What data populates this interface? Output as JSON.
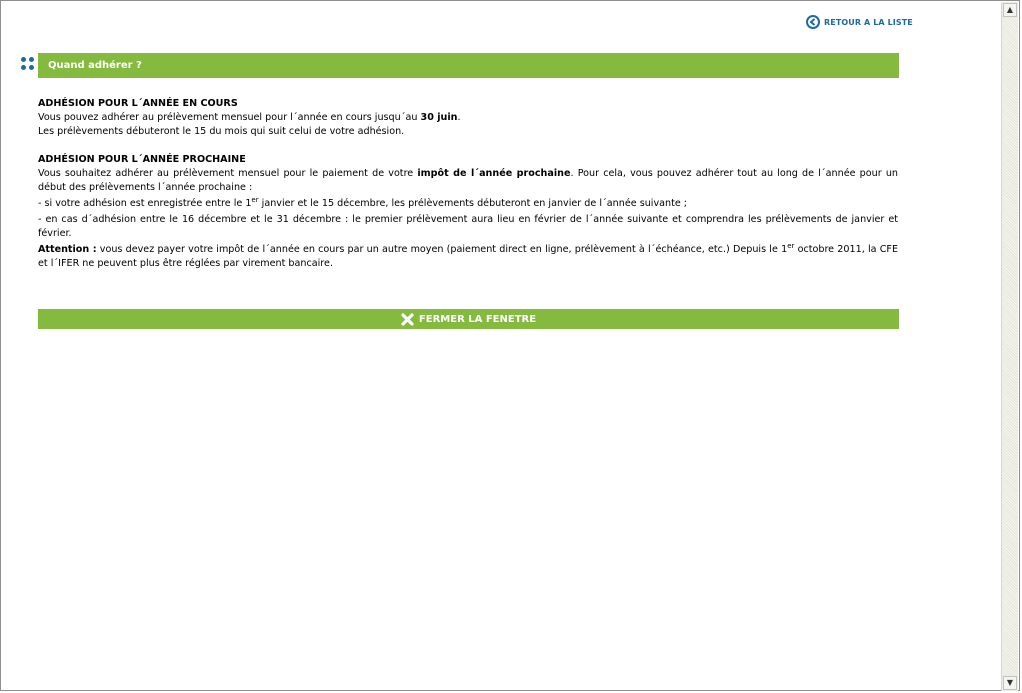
{
  "header": {
    "back_link_label": "RETOUR A LA LISTE"
  },
  "section": {
    "title": "Quand adhérer ?"
  },
  "current_year": {
    "heading": "ADHÉSION POUR L´ANNÉE EN COURS",
    "line1_prefix": "Vous pouvez adhérer au prélèvement mensuel pour l´année en cours jusqu´au ",
    "line1_bold": "30 juin",
    "line1_suffix": ".",
    "line2": "Les prélèvements débuteront le 15 du mois qui suit celui de votre adhésion."
  },
  "next_year": {
    "heading": "ADHÉSION POUR L´ANNÉE PROCHAINE",
    "intro_prefix": "Vous souhaitez adhérer au prélèvement mensuel pour le paiement de votre ",
    "intro_bold": "impôt de l´année prochaine",
    "intro_suffix": ". Pour cela, vous pouvez adhérer tout au long de l´année pour un début des prélèvements l´année prochaine :",
    "bullet1_prefix": "- si votre adhésion est enregistrée entre le 1",
    "bullet1_sup": "er",
    "bullet1_suffix": " janvier et le 15 décembre, les prélèvements débuteront en janvier de l´année suivante ;",
    "bullet2": "- en cas d´adhésion entre le 16 décembre et le 31 décembre :  le premier prélèvement aura lieu en février de l´année suivante et comprendra les prélèvements de janvier et février.",
    "attention_bold": "Attention :",
    "attention_text1": " vous devez payer votre impôt de l´année en cours par un autre moyen (paiement direct en ligne, prélèvement à l´échéance, etc.) Depuis le 1",
    "attention_sup": "er",
    "attention_text2": " octobre 2011, la CFE et l´IFER ne peuvent plus être réglées par virement bancaire."
  },
  "footer": {
    "close_label": "FERMER LA FENETRE"
  },
  "colors": {
    "green": "#84bb3f",
    "blue": "#1e6aa3"
  }
}
